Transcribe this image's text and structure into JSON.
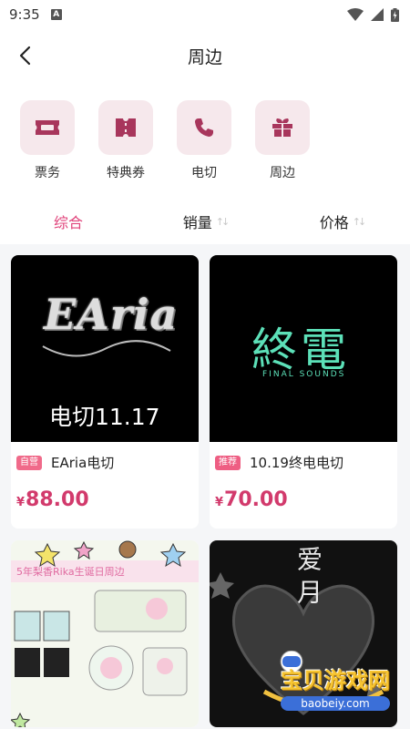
{
  "status_bar": {
    "time": "9:35",
    "notif_icon": "a-icon"
  },
  "nav": {
    "title": "周边"
  },
  "categories": [
    {
      "label": "票务",
      "icon": "ticket-icon"
    },
    {
      "label": "特典券",
      "icon": "coupon-icon"
    },
    {
      "label": "电切",
      "icon": "phone-icon"
    },
    {
      "label": "周边",
      "icon": "gift-icon"
    }
  ],
  "sort": {
    "comprehensive": "综合",
    "sales": "销量",
    "price": "价格",
    "active_color": "#e0427a"
  },
  "products": [
    {
      "tag": "自营",
      "title": "EAria电切",
      "currency": "¥",
      "price": "88.00",
      "image_text": "电切11.17",
      "logo_text": "EAria"
    },
    {
      "tag": "推荐",
      "title": "10.19终电电切",
      "currency": "¥",
      "price": "70.00",
      "logo_text": "終電",
      "logo_sub": "FINAL SOUNDS"
    },
    {
      "banner_text": "5年梨香Rika生诞日周边"
    },
    {
      "art_text": "爱月"
    }
  ],
  "watermark": {
    "main": "宝贝游戏网",
    "sub": "baobeiy.com"
  },
  "colors": {
    "accent": "#e0427a",
    "price": "#d23a6c",
    "tile_bg": "#f6e8ec",
    "mint": "#5ce0b8"
  }
}
